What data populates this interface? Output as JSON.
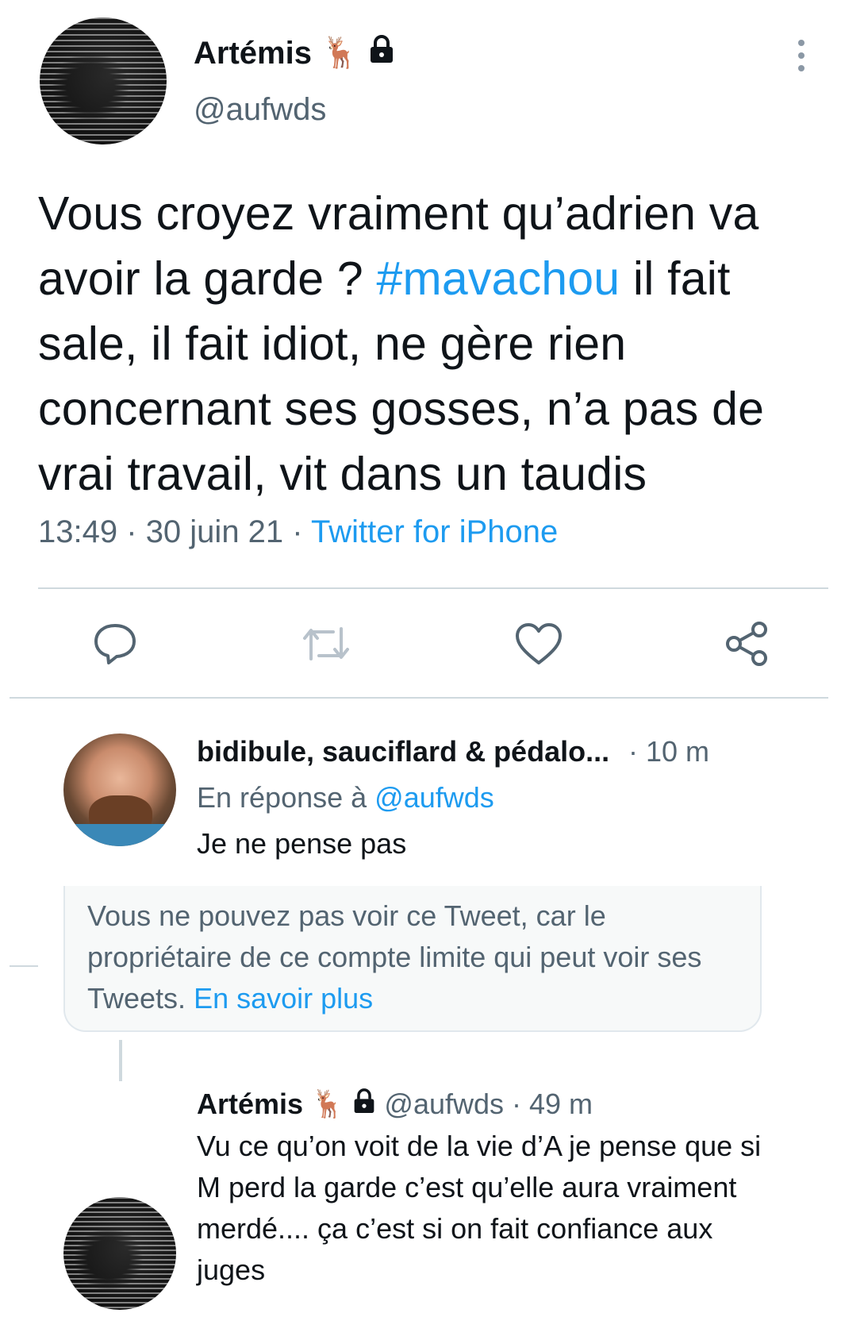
{
  "main_tweet": {
    "author_name": "Artémis",
    "author_emoji": "🦌",
    "author_lock_icon": "lock-icon",
    "author_handle": "@aufwds",
    "text_before_hashtag": "Vous croyez vraiment qu’adrien va avoir la garde ? ",
    "hashtag": "#mavachou",
    "text_after_hashtag": " il fait sale, il fait idiot, ne gère rien concernant ses gosses, n’a pas de vrai travail, vit dans un taudis",
    "time": "13:49",
    "date": "30 juin 21",
    "separator": "·",
    "source": "Twitter for iPhone"
  },
  "actions": {
    "reply_icon": "comment-icon",
    "retweet_icon": "retweet-icon",
    "like_icon": "heart-icon",
    "share_icon": "share-icon"
  },
  "reply_1": {
    "author_name": "bidibule, sauciflard & pédalo...",
    "time": "· 10 m",
    "reply_prefix": "En réponse à ",
    "reply_mention": "@aufwds",
    "text": "Je ne pense pas"
  },
  "hidden_notice": {
    "text": "Vous ne pouvez pas voir ce Tweet, car le propriétaire de ce compte limite qui peut voir ses Tweets. ",
    "link": "En savoir plus"
  },
  "reply_2": {
    "author_name": "Artémis",
    "author_emoji": "🦌",
    "handle": "@aufwds",
    "time": "· 49 m",
    "text": "Vu ce qu’on voit de la vie d’A je pense que si M perd la garde c’est qu’elle aura vraiment merdé.... ça c’est si on fait confiance aux juges"
  },
  "colors": {
    "accent": "#1d9bf0",
    "secondary_text": "#536471",
    "primary_text": "#0f1419",
    "divider": "#cfd9de"
  }
}
